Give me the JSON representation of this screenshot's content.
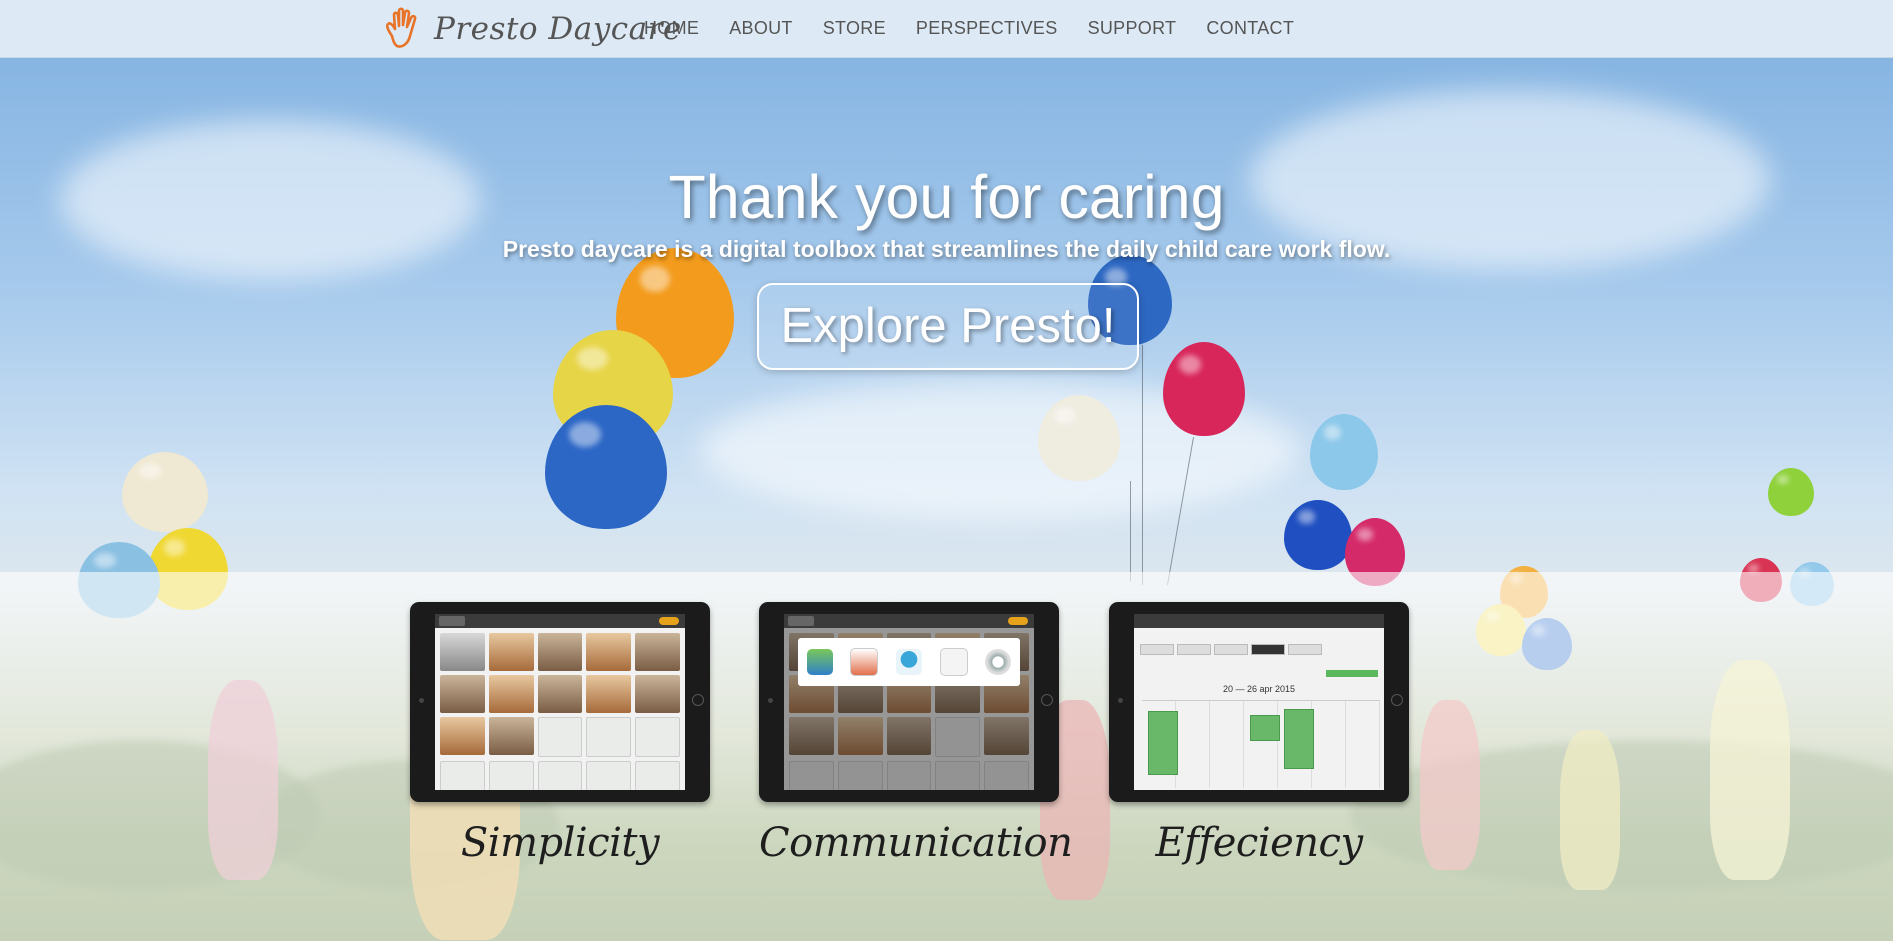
{
  "brand": {
    "name": "Presto Daycare",
    "logo_icon": "hand-icon",
    "accent": "#e8742a"
  },
  "nav": {
    "items": [
      {
        "label": "HOME"
      },
      {
        "label": "ABOUT"
      },
      {
        "label": "STORE"
      },
      {
        "label": "PERSPECTIVES"
      },
      {
        "label": "SUPPORT"
      },
      {
        "label": "CONTACT"
      }
    ]
  },
  "hero": {
    "title": "Thank you for caring",
    "subtitle": "Presto daycare is a digital toolbox that streamlines the daily child care work flow.",
    "cta_label": "Explore Presto!"
  },
  "features": [
    {
      "label": "Simplicity"
    },
    {
      "label": "Communication"
    },
    {
      "label": "Effeciency"
    }
  ],
  "calendar_preview": {
    "date_range": "20 — 26 apr 2015"
  }
}
